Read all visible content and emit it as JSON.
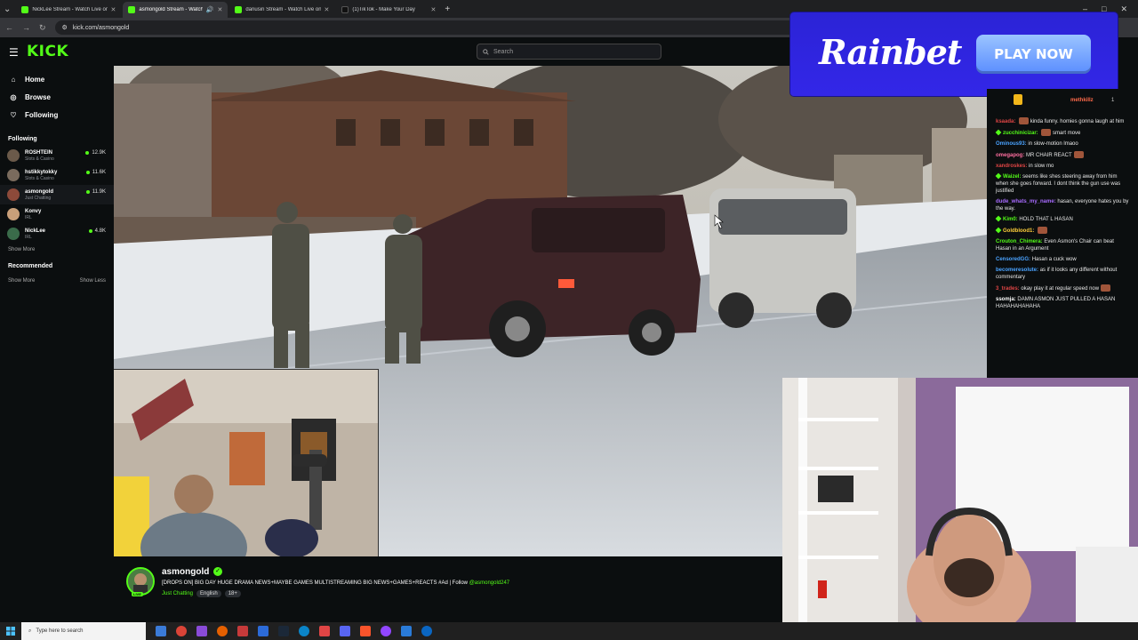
{
  "browser": {
    "tabs": [
      {
        "title": "NickLee Stream - Watch Live on",
        "active": false
      },
      {
        "title": "asmongold Stream - Watch",
        "active": true
      },
      {
        "title": "dariusiri Stream - Watch Live on",
        "active": false
      },
      {
        "title": "(1)TikTok - Make Your Day",
        "active": false
      }
    ],
    "new_tab": "+",
    "url": "kick.com/asmongold",
    "window_controls": [
      "–",
      "□",
      "✕"
    ]
  },
  "header": {
    "logo": "KICK",
    "search_placeholder": "Search"
  },
  "sidebar": {
    "nav": [
      {
        "label": "Home",
        "icon": "home-icon"
      },
      {
        "label": "Browse",
        "icon": "compass-icon"
      },
      {
        "label": "Following",
        "icon": "heart-icon"
      }
    ],
    "following_title": "Following",
    "channels": [
      {
        "name": "ROSHTEIN",
        "category": "Slots & Casino",
        "viewers": "12.9K",
        "color": "#6b5a4a"
      },
      {
        "name": "hstikkytokky",
        "category": "Slots & Casino",
        "viewers": "11.6K",
        "color": "#7a6b5d"
      },
      {
        "name": "asmongold",
        "category": "Just Chatting",
        "viewers": "11.9K",
        "color": "#8d4a3a"
      },
      {
        "name": "Konvy",
        "category": "IRL",
        "viewers": "",
        "color": "#c9a07a"
      },
      {
        "name": "NickLee",
        "category": "IRL",
        "viewers": "4.8K",
        "color": "#3a6b4a"
      }
    ],
    "show_more": "Show More",
    "recommended_title": "Recommended",
    "show_more_2": "Show More",
    "show_less": "Show Less"
  },
  "ad": {
    "brand": "Rainbet",
    "cta": "PLAY NOW"
  },
  "chat": {
    "messages": [
      {
        "user": "ksaada:",
        "color": "#e04545",
        "text": "kinda funny. homies gonna laugh at him",
        "emote": true,
        "badge": false
      },
      {
        "user": "zucchinicizar:",
        "color": "#53fc18",
        "text": "smart move",
        "emote": true,
        "badge": true
      },
      {
        "user": "Ominous93:",
        "color": "#4aa3ff",
        "text": "in slow-motion lmaoo",
        "emote": false,
        "badge": false
      },
      {
        "user": "omegapog:",
        "color": "#ff6fa0",
        "text": "MR CHAIR REACT",
        "emote": true,
        "badge": false
      },
      {
        "user": "xandroskes:",
        "color": "#e04545",
        "text": "in slow mo",
        "emote": false,
        "badge": false
      },
      {
        "user": "Waizel:",
        "color": "#53fc18",
        "text": "seems like shes steering away from him when she goes forward. I dont think the gun use was justified",
        "emote": false,
        "badge": true
      },
      {
        "user": "dude_whats_my_name:",
        "color": "#a86bff",
        "text": "hasan, everyone hates you by the way.",
        "emote": false,
        "badge": false
      },
      {
        "user": "Kim0:",
        "color": "#53fc18",
        "text": "HOLD THAT L HASAN",
        "emote": false,
        "badge": true
      },
      {
        "user": "Goldblood1:",
        "color": "#ffcf3a",
        "text": "",
        "emote": true,
        "badge": true
      },
      {
        "user": "Crouton_Chimera:",
        "color": "#53fc18",
        "text": "Even Asmon's Chair can beat Hasan in an Argument",
        "emote": false,
        "badge": false
      },
      {
        "user": "CensoredGG:",
        "color": "#4aa3ff",
        "text": "Hasan a cuck wow",
        "emote": false,
        "badge": false
      },
      {
        "user": "becomeresolute:",
        "color": "#4aa3ff",
        "text": "as if it looks any different without commentary",
        "emote": false,
        "badge": false
      },
      {
        "user": "3_trades:",
        "color": "#e04545",
        "text": "okay play it at regular speed now",
        "emote": true,
        "badge": false
      },
      {
        "user": "ssomja:",
        "color": "#ffffff",
        "text": "DAMN ASMON JUST PULLED A HASAN HAHAHAHAHAHA",
        "emote": false,
        "badge": false
      }
    ],
    "top_user_right": "methkillz",
    "top_count": "1"
  },
  "stream": {
    "streamer": "asmongold",
    "live_badge": "LIVE",
    "title_prefix": "[DROPS ON] BIG DAY HUGE DRAMA NEWS+MAYBE GAMES MULTISTREAMING BIG NEWS+GAMES+REACTS #Ad | Follow ",
    "title_follow": "@asmongold247",
    "category": "Just Chatting",
    "tags": [
      "English",
      "18+"
    ]
  },
  "taskbar": {
    "search_placeholder": "Type here to search"
  }
}
